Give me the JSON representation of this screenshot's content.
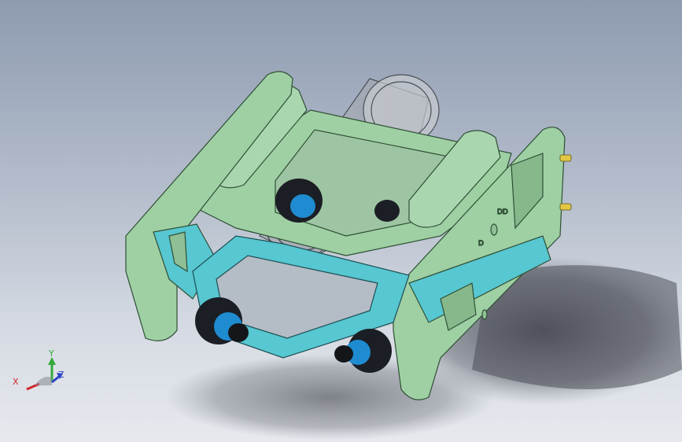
{
  "viewport": {
    "background_top": "#8e9bb0",
    "background_bottom": "#e6e9ee"
  },
  "model": {
    "part_colors": {
      "frame": "#9fd0a4",
      "frame_edge": "#2f4f35",
      "cyan_plate": "#57c7d1",
      "thruster_body": "#1b1e24",
      "thruster_accent": "#1f8bd0",
      "transparent_tube": "#a9aeb4",
      "shadow": "#4f525a"
    },
    "side_plate_markings": [
      "D",
      "DD"
    ]
  },
  "triad": {
    "x_label": "X",
    "y_label": "Y",
    "z_label": "Z",
    "x_color": "#d3242b",
    "y_color": "#35a83a",
    "z_color": "#2a44c8"
  }
}
